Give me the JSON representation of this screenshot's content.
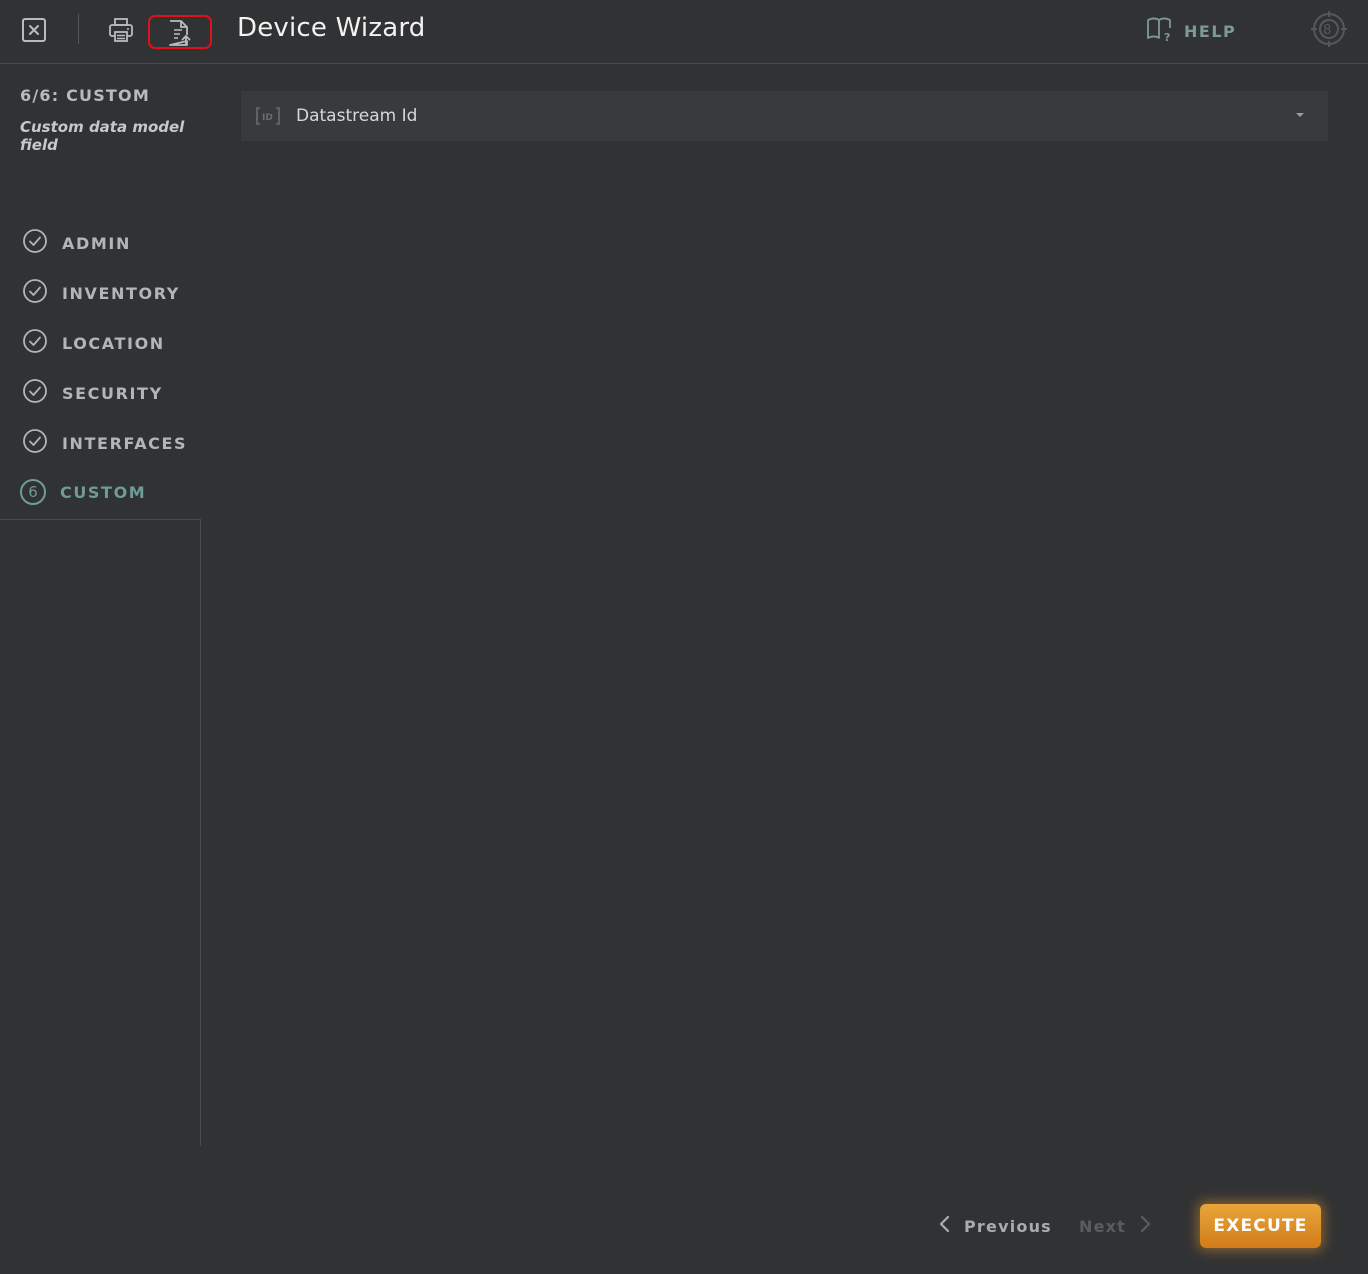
{
  "header": {
    "title": "Device Wizard",
    "help_label": "HELP",
    "icons": [
      "close-icon",
      "print-icon",
      "export-document-icon",
      "help-book-icon",
      "settings-target-icon"
    ]
  },
  "sidebar": {
    "step_heading": "6/6: CUSTOM",
    "step_description": "Custom data model field",
    "items": [
      {
        "label": "ADMIN",
        "state": "done"
      },
      {
        "label": "INVENTORY",
        "state": "done"
      },
      {
        "label": "LOCATION",
        "state": "done"
      },
      {
        "label": "SECURITY",
        "state": "done"
      },
      {
        "label": "INTERFACES",
        "state": "done"
      },
      {
        "label": "CUSTOM",
        "state": "active",
        "number": "6"
      }
    ]
  },
  "main": {
    "field_label": "Datastream Id",
    "field_icon_text": "ID"
  },
  "footer": {
    "previous_label": "Previous",
    "next_label": "Next",
    "execute_label": "EXECUTE"
  },
  "colors": {
    "background": "#313234",
    "accent_teal": "#6f9c97",
    "execute_orange": "#e09330",
    "highlight_red": "#e2101a"
  }
}
